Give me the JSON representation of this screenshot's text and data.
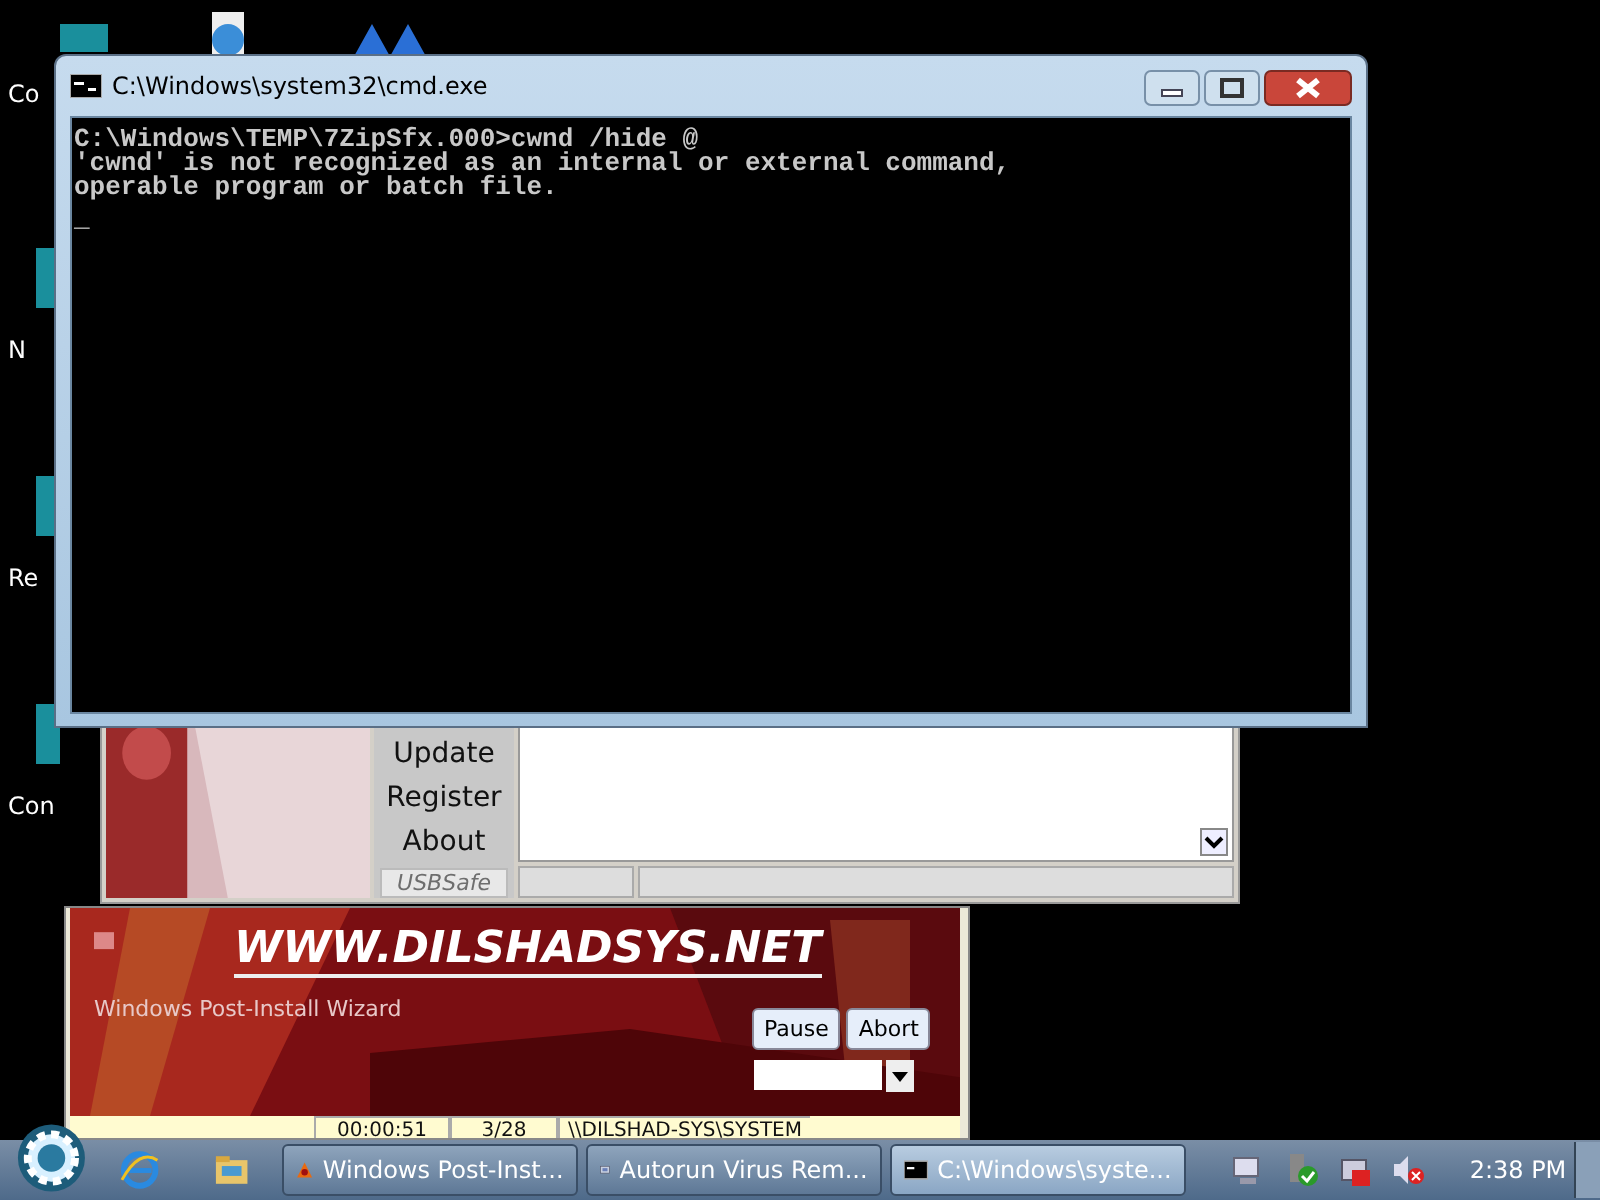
{
  "desktop_icons": [
    {
      "label": "Co"
    },
    {
      "label": "N"
    },
    {
      "label": "Re"
    },
    {
      "label": "Con"
    }
  ],
  "autorun_window": {
    "side_buttons": [
      "Update",
      "Register",
      "About"
    ],
    "usbsafe": "USBSafe",
    "usbsafe_disabled": true
  },
  "wizard_window": {
    "watermark": "Windows Post-Install Wizard",
    "banner": "WWW.DILSHADSYS.NET",
    "buttons": [
      "Pause",
      "Abort"
    ],
    "status_cells": [
      "00:00:51",
      "3/28",
      "\\\\DILSHAD-SYS\\SYSTEM"
    ]
  },
  "cmd_window": {
    "title": "C:\\Windows\\system32\\cmd.exe",
    "lines": [
      "C:\\Windows\\TEMP\\7ZipSfx.000>cwnd /hide @",
      "'cwnd' is not recognized as an internal or external command,",
      "operable program or batch file."
    ],
    "cursor": "_"
  },
  "taskbar": {
    "tasks": [
      {
        "label": "Windows Post-Inst...",
        "kind": "wizard",
        "selected": false
      },
      {
        "label": "Autorun Virus Rem...",
        "kind": "autorun",
        "selected": false
      },
      {
        "label": "C:\\Windows\\syste...",
        "kind": "cmd",
        "selected": true
      }
    ],
    "clock": "2:38 PM"
  }
}
